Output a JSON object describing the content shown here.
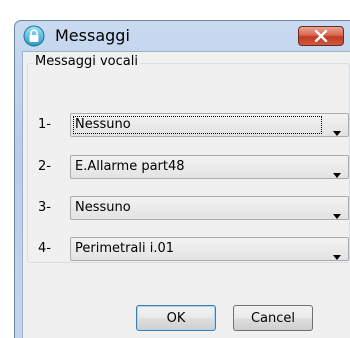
{
  "window": {
    "title": "Messaggi",
    "icons": {
      "app": "lock-icon",
      "close": "close-icon"
    }
  },
  "group": {
    "label": "Messaggi vocali",
    "rows": [
      {
        "index_label": "1-",
        "selected": "Nessuno"
      },
      {
        "index_label": "2-",
        "selected": "E.Allarme part48"
      },
      {
        "index_label": "3-",
        "selected": "Nessuno"
      },
      {
        "index_label": "4-",
        "selected": "Perimetrali i.01"
      }
    ]
  },
  "buttons": {
    "ok_label": "OK",
    "cancel_label": "Cancel"
  },
  "colors": {
    "titlebar": "#b8cde9",
    "close": "#c13b22",
    "default_border": "#3c7fb1"
  }
}
